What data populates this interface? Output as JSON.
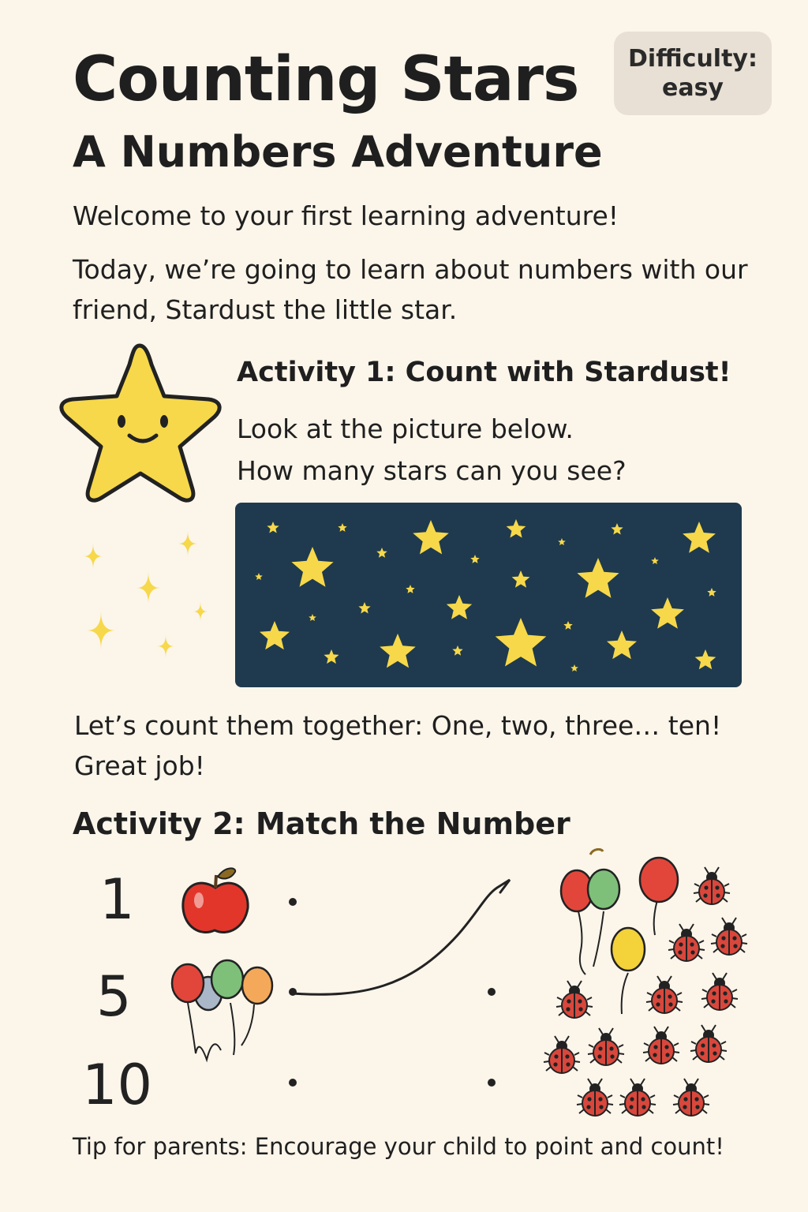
{
  "header": {
    "title": "Counting Stars",
    "subtitle": "A Numbers Adventure",
    "difficulty_line1": "Difficulty:",
    "difficulty_line2": "easy"
  },
  "intro": {
    "welcome": "Welcome to your first learning adventure!",
    "text": "Today, we’re going to learn about numbers with our friend, Stardust the little star."
  },
  "activity1": {
    "title": "Activity 1: Count with Stardust!",
    "line1": "Look at the picture below.",
    "line2": "How many stars can you see?",
    "count_text": "Let’s count them together: One, two, three… ten! Great job!"
  },
  "activity2": {
    "title": "Activity 2: Match the Number",
    "numbers": [
      "1",
      "5",
      "10"
    ],
    "left_pictures": [
      "apple-icon",
      "balloons-icon"
    ],
    "right_pictures": [
      "balloons-icon",
      "ladybugs-icon"
    ]
  },
  "footer": {
    "tip": "Tip for parents: Encourage your child to point and count!"
  },
  "colors": {
    "background": "#fbf5ea",
    "badge": "#e8e0d4",
    "sky": "#1f3a4e",
    "star": "#f6d84a",
    "ladybug": "#d9473c"
  }
}
